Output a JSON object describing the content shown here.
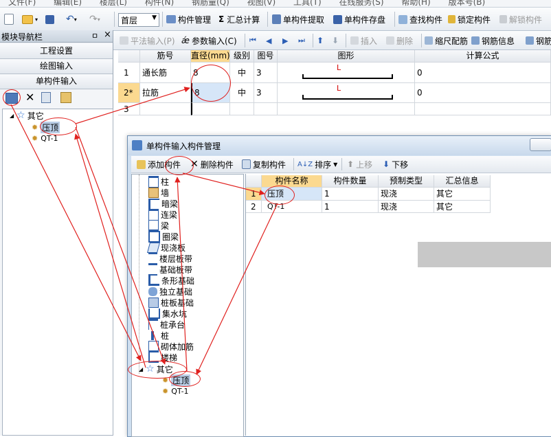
{
  "menubar": {
    "items": [
      "文件(F)",
      "编辑(E)",
      "楼层(L)",
      "构件(N)",
      "钢筋量(Q)",
      "视图(V)",
      "工具(T)",
      "在线服务(S)",
      "帮助(H)",
      "版本号(B)"
    ]
  },
  "toolbar1": {
    "floor_value": "首层",
    "buttons": [
      "构件管理",
      "汇总计算",
      "单构件提取",
      "单构件存盘",
      "查找构件",
      "锁定构件",
      "解锁构件"
    ],
    "sigma": "Σ"
  },
  "toolbar2": {
    "buttons": [
      "平法输入(P)",
      "参数输入(C)",
      "插入",
      "删除",
      "缩尺配筋",
      "钢筋信息",
      "钢筋"
    ]
  },
  "sidebar": {
    "title": "模块导航栏",
    "pin": "ㅁ",
    "close": "×",
    "nav": [
      "工程设置",
      "绘图输入",
      "单构件输入"
    ],
    "tree": {
      "root": "其它",
      "items": [
        "压顶",
        "QT-1"
      ]
    }
  },
  "grid": {
    "headers": [
      "",
      "筋号",
      "直径(mm)",
      "级别",
      "图号",
      "图形",
      "计算公式"
    ],
    "rows": [
      {
        "num": "1",
        "name": "通长筋",
        "dia": "8",
        "grade": "中",
        "fig": "3",
        "shape": "L",
        "formula": "0"
      },
      {
        "num": "2*",
        "name": "拉筋",
        "dia": "8",
        "grade": "中",
        "fig": "3",
        "shape": "L",
        "formula": "0"
      },
      {
        "num": "3",
        "name": "",
        "dia": "",
        "grade": "",
        "fig": "",
        "shape": "",
        "formula": ""
      }
    ]
  },
  "dialog": {
    "title": "单构件输入构件管理",
    "toolbar": [
      "添加构件",
      "删除构件",
      "复制构件",
      "排序",
      "上移",
      "下移"
    ],
    "tree": [
      "柱",
      "墙",
      "暗梁",
      "连梁",
      "梁",
      "圈梁",
      "现浇板",
      "楼层板带",
      "基础板带",
      "条形基础",
      "独立基础",
      "桩板基础",
      "集水坑",
      "桩承台",
      "桩",
      "砌体加筋",
      "楼梯",
      "其它"
    ],
    "tree_children": [
      "压顶",
      "QT-1"
    ],
    "table_headers": [
      "",
      "构件名称",
      "构件数量",
      "预制类型",
      "汇总信息"
    ],
    "table_rows": [
      {
        "num": "1",
        "name": "压顶",
        "count": "1",
        "type": "现浇",
        "summary": "其它"
      },
      {
        "num": "2",
        "name": "QT-1",
        "count": "1",
        "type": "现浇",
        "summary": "其它"
      }
    ]
  }
}
